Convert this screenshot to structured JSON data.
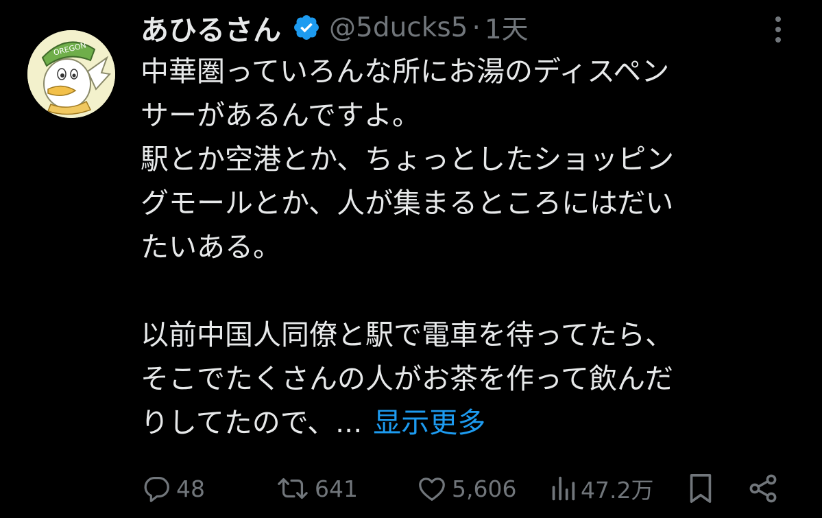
{
  "post": {
    "author_name": "あひるさん",
    "handle": "@5ducks5",
    "separator": "·",
    "time": "1天",
    "body_lines": [
      "中華圏っていろんな所にお湯のディスペン",
      "サーがあるんですよ。",
      "駅とか空港とか、ちょっとしたショッピン",
      "グモールとか、人が集まるところにはだい",
      "たいある。",
      "",
      "以前中国人同僚と駅で電車を待ってたら、",
      "そこでたくさんの人がお茶を作って飲んだ",
      "りしてたので、..."
    ],
    "show_more_label": "显示更多",
    "avatar_text": "OREGON"
  },
  "actions": {
    "reply_count": "48",
    "repost_count": "641",
    "like_count": "5,606",
    "views_count": "47.2万"
  },
  "icons": {
    "verified": "verified-badge-icon",
    "more": "more-options-icon",
    "reply": "reply-icon",
    "repost": "repost-icon",
    "like": "heart-icon",
    "views": "views-chart-icon",
    "bookmark": "bookmark-icon",
    "share": "share-icon"
  },
  "colors": {
    "background": "#000000",
    "text": "#e7e9ea",
    "secondary": "#71767b",
    "link": "#1d9bf0"
  }
}
